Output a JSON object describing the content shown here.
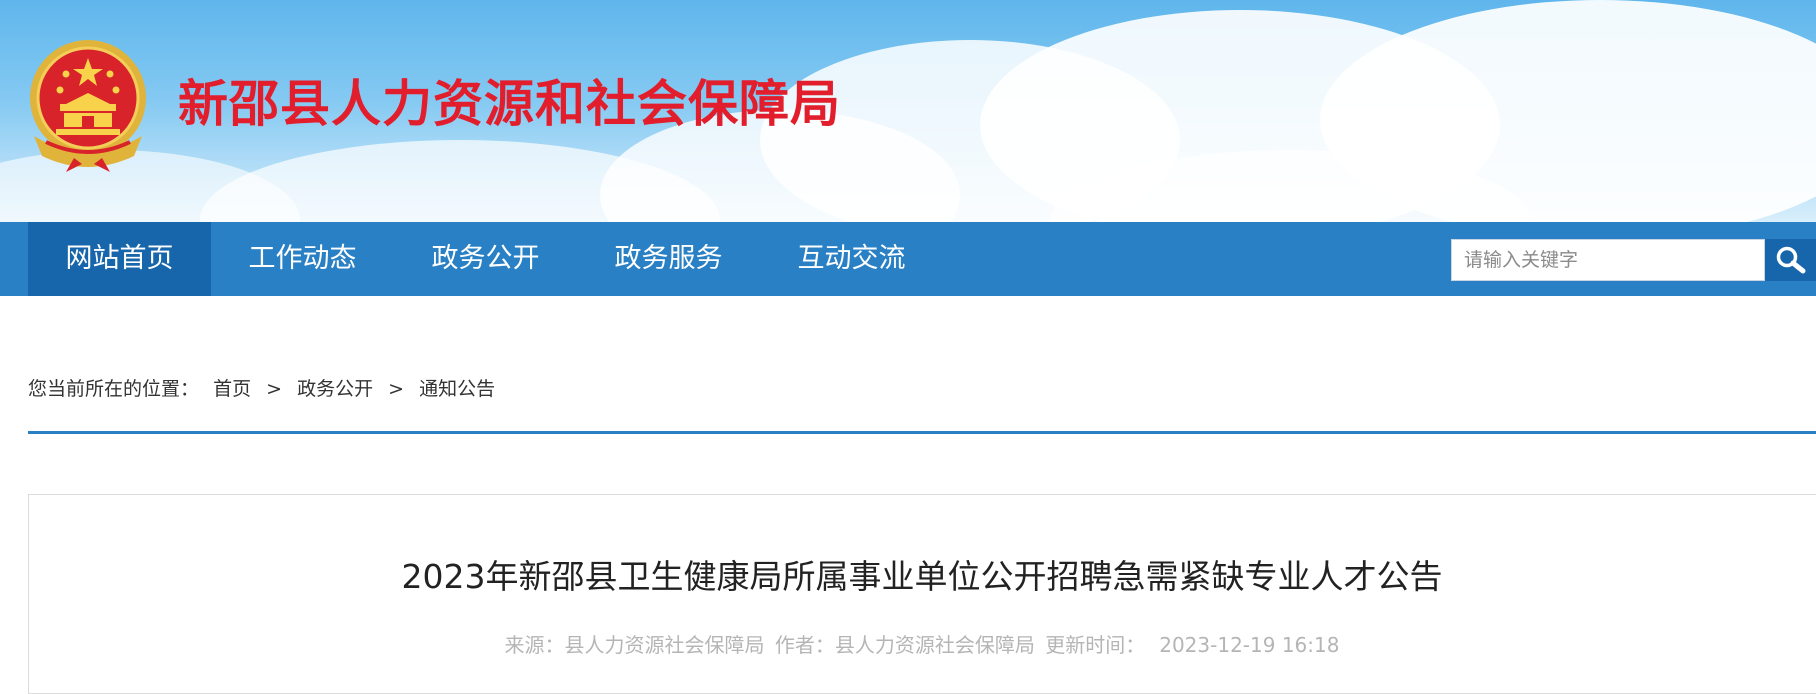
{
  "header": {
    "site_title": "新邵县人力资源和社会保障局",
    "emblem_icon": "national-emblem-icon",
    "title_color": "#e21e2c"
  },
  "nav": {
    "items": [
      {
        "label": "网站首页",
        "active": true
      },
      {
        "label": "工作动态",
        "active": false
      },
      {
        "label": "政务公开",
        "active": false
      },
      {
        "label": "政务服务",
        "active": false
      },
      {
        "label": "互动交流",
        "active": false
      }
    ],
    "bar_color": "#2a80c4",
    "active_color": "#1766ab"
  },
  "search": {
    "placeholder": "请输入关键字",
    "value": "",
    "button_icon": "search-icon"
  },
  "breadcrumb": {
    "prefix": "您当前所在的位置：",
    "items": [
      "首页",
      "政务公开",
      "通知公告"
    ],
    "separator": ">"
  },
  "article": {
    "title": "2023年新邵县卫生健康局所属事业单位公开招聘急需紧缺专业人才公告",
    "source_label": "来源：",
    "source": "县人力资源社会保障局",
    "author_label": "作者：",
    "author": "县人力资源社会保障局",
    "updated_label": "更新时间：",
    "updated": "2023-12-19 16:18"
  }
}
